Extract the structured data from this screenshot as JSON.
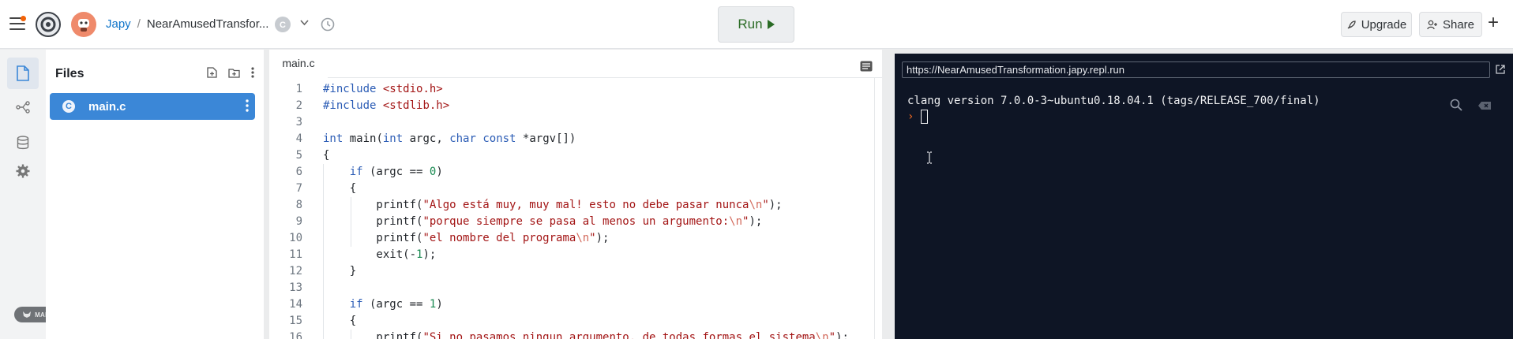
{
  "header": {
    "user": "Japy",
    "separator": "/",
    "repl_name": "NearAmusedTransfor...",
    "run_label": "Run",
    "upgrade_label": "Upgrade",
    "share_label": "Share"
  },
  "files": {
    "title": "Files",
    "items": [
      {
        "name": "main.c",
        "icon": "c-language-icon"
      }
    ]
  },
  "editor": {
    "tab": "main.c",
    "lines": [
      "#include <stdio.h>",
      "#include <stdlib.h>",
      "",
      "int main(int argc, char const *argv[])",
      "{",
      "    if (argc == 0)",
      "    {",
      "        printf(\"Algo está muy, muy mal! esto no debe pasar nunca\\n\");",
      "        printf(\"porque siempre se pasa al menos un argumento:\\n\");",
      "        printf(\"el nombre del programa\\n\");",
      "        exit(-1);",
      "    }",
      "",
      "    if (argc == 1)",
      "    {",
      "        printf(\"Si no pasamos ningun argumento, de todas formas el sistema\\n\");"
    ]
  },
  "console": {
    "url": "https://NearAmusedTransformation.japy.repl.run",
    "output": "clang version 7.0.0-3~ubuntu0.18.04.1 (tags/RELEASE_700/final)",
    "prompt": "›"
  },
  "watermark": "MADE WITH GIFOX",
  "colors": {
    "accent": "#3b87d7",
    "run_green": "#2a6b25",
    "console_bg": "#0e1525",
    "prompt_orange": "#f26a21"
  }
}
